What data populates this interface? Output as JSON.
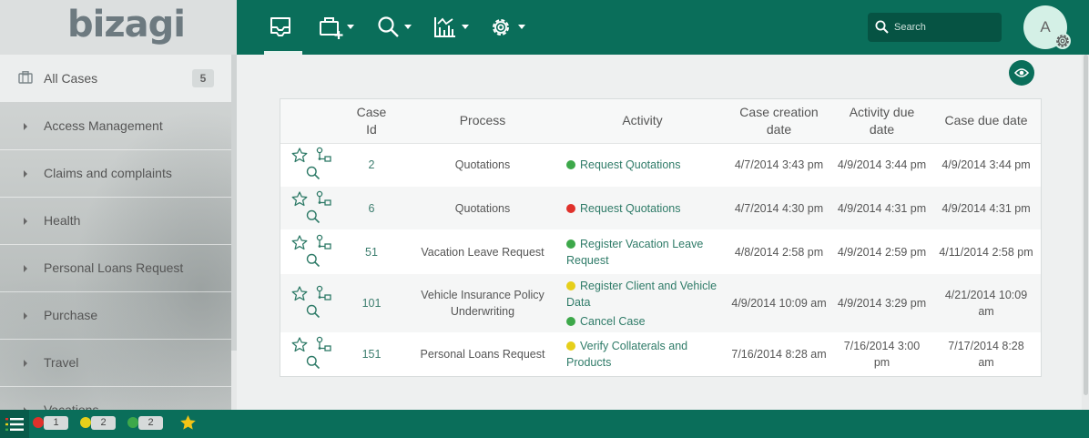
{
  "brand": {
    "logo_text": "bizagi"
  },
  "sidebar": {
    "all_cases": {
      "label": "All Cases",
      "count": "5"
    },
    "items": [
      {
        "label": "Access Management"
      },
      {
        "label": "Claims and complaints"
      },
      {
        "label": "Health"
      },
      {
        "label": "Personal Loans Request"
      },
      {
        "label": "Purchase"
      },
      {
        "label": "Travel"
      },
      {
        "label": "Vacations"
      }
    ]
  },
  "topbar": {
    "nav": [
      {
        "name": "inbox-icon"
      },
      {
        "name": "new-case-icon"
      },
      {
        "name": "search-icon"
      },
      {
        "name": "analytics-icon"
      },
      {
        "name": "settings-icon"
      }
    ],
    "search": {
      "placeholder": "Search"
    },
    "avatar": {
      "initial": "A"
    }
  },
  "table": {
    "headers": [
      "",
      "Case Id",
      "Process",
      "Activity",
      "Case creation date",
      "Activity due date",
      "Case due date"
    ],
    "rows": [
      {
        "id": "2",
        "process": "Quotations",
        "activities": [
          {
            "status": "green",
            "label": "Request Quotations"
          }
        ],
        "created": "4/7/2014 3:43 pm",
        "activity_due": "4/9/2014 3:44 pm",
        "case_due": "4/9/2014 3:44 pm"
      },
      {
        "id": "6",
        "process": "Quotations",
        "activities": [
          {
            "status": "red",
            "label": "Request Quotations"
          }
        ],
        "created": "4/7/2014 4:30 pm",
        "activity_due": "4/9/2014 4:31 pm",
        "case_due": "4/9/2014 4:31 pm"
      },
      {
        "id": "51",
        "process": "Vacation Leave Request",
        "activities": [
          {
            "status": "green",
            "label": "Register Vacation Leave Request"
          }
        ],
        "created": "4/8/2014 2:58 pm",
        "activity_due": "4/9/2014 2:59 pm",
        "case_due": "4/11/2014 2:58 pm"
      },
      {
        "id": "101",
        "process": "Vehicle Insurance Policy Underwriting",
        "activities": [
          {
            "status": "yellow",
            "label": "Register Client and Vehicle Data"
          },
          {
            "status": "green",
            "label": "Cancel Case"
          }
        ],
        "created": "4/9/2014 10:09 am",
        "activity_due": "4/9/2014 3:29 pm",
        "case_due": "4/21/2014 10:09 am"
      },
      {
        "id": "151",
        "process": "Personal Loans Request",
        "activities": [
          {
            "status": "yellow",
            "label": "Verify Collaterals and Products"
          }
        ],
        "created": "7/16/2014 8:28 am",
        "activity_due": "7/16/2014 3:00 pm",
        "case_due": "7/17/2014 8:28 am"
      }
    ]
  },
  "bottombar": {
    "counters": [
      {
        "status": "red",
        "count": "1"
      },
      {
        "status": "yellow",
        "count": "2"
      },
      {
        "status": "green",
        "count": "2"
      }
    ]
  },
  "colors": {
    "brand_green": "#0a6e5a",
    "red": "#e0312b",
    "yellow": "#e6cf1a",
    "green": "#3da84a"
  }
}
